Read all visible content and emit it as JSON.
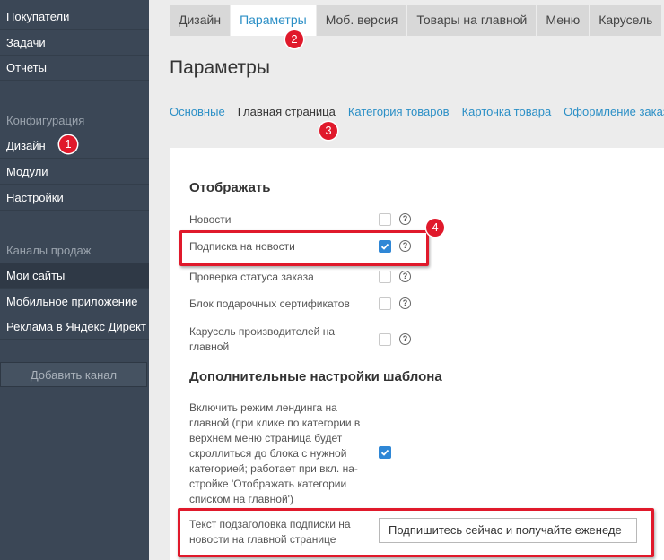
{
  "sidebar": {
    "items_top": [
      "Покупатели",
      "Задачи",
      "Отчеты"
    ],
    "config_header": "Конфигурация",
    "config_items": [
      "Дизайн",
      "Модули",
      "Настройки"
    ],
    "channels_header": "Каналы продаж",
    "channel_items": [
      "Мои сайты",
      "Мобильное приложение",
      "Реклама в Яндекс Директ"
    ],
    "add_channel": "Добавить канал"
  },
  "tabs": [
    "Дизайн",
    "Параметры",
    "Моб. версия",
    "Товары на главной",
    "Меню",
    "Карусель"
  ],
  "page_title": "Параметры",
  "subtabs": [
    "Основные",
    "Главная страница",
    "Категория товаров",
    "Карточка товара",
    "Оформление заказа"
  ],
  "display": {
    "header": "Отображать",
    "options": [
      {
        "label": "Новости",
        "checked": false
      },
      {
        "label": "Подписка на новости",
        "checked": true
      },
      {
        "label": "Проверка статуса заказа",
        "checked": false
      },
      {
        "label": "Блок подарочных сертификатов",
        "checked": false
      },
      {
        "label": "Карусель производителей на главной",
        "checked": false
      }
    ]
  },
  "extra": {
    "header": "Дополнительные настройки шаблона",
    "landing_label": "Включить режим лендинга на главной (при клике по категории в верхнем меню страница будет скроллиться до блока с нужной категорией; работает при вкл. на-стройке 'Отображать категории списком на главной')",
    "landing_checked": true,
    "subscribe_label": "Текст подзаголовка подписки на новости на главной странице",
    "subscribe_value": "Подпишитесь сейчас и получайте еженеде"
  },
  "badges": [
    "1",
    "2",
    "3",
    "4"
  ],
  "help_glyph": "?",
  "colors": {
    "accent": "#2b8fc6",
    "checkbox": "#2f87d6",
    "annotation": "#e0192b",
    "sidebar": "#3b4756"
  }
}
